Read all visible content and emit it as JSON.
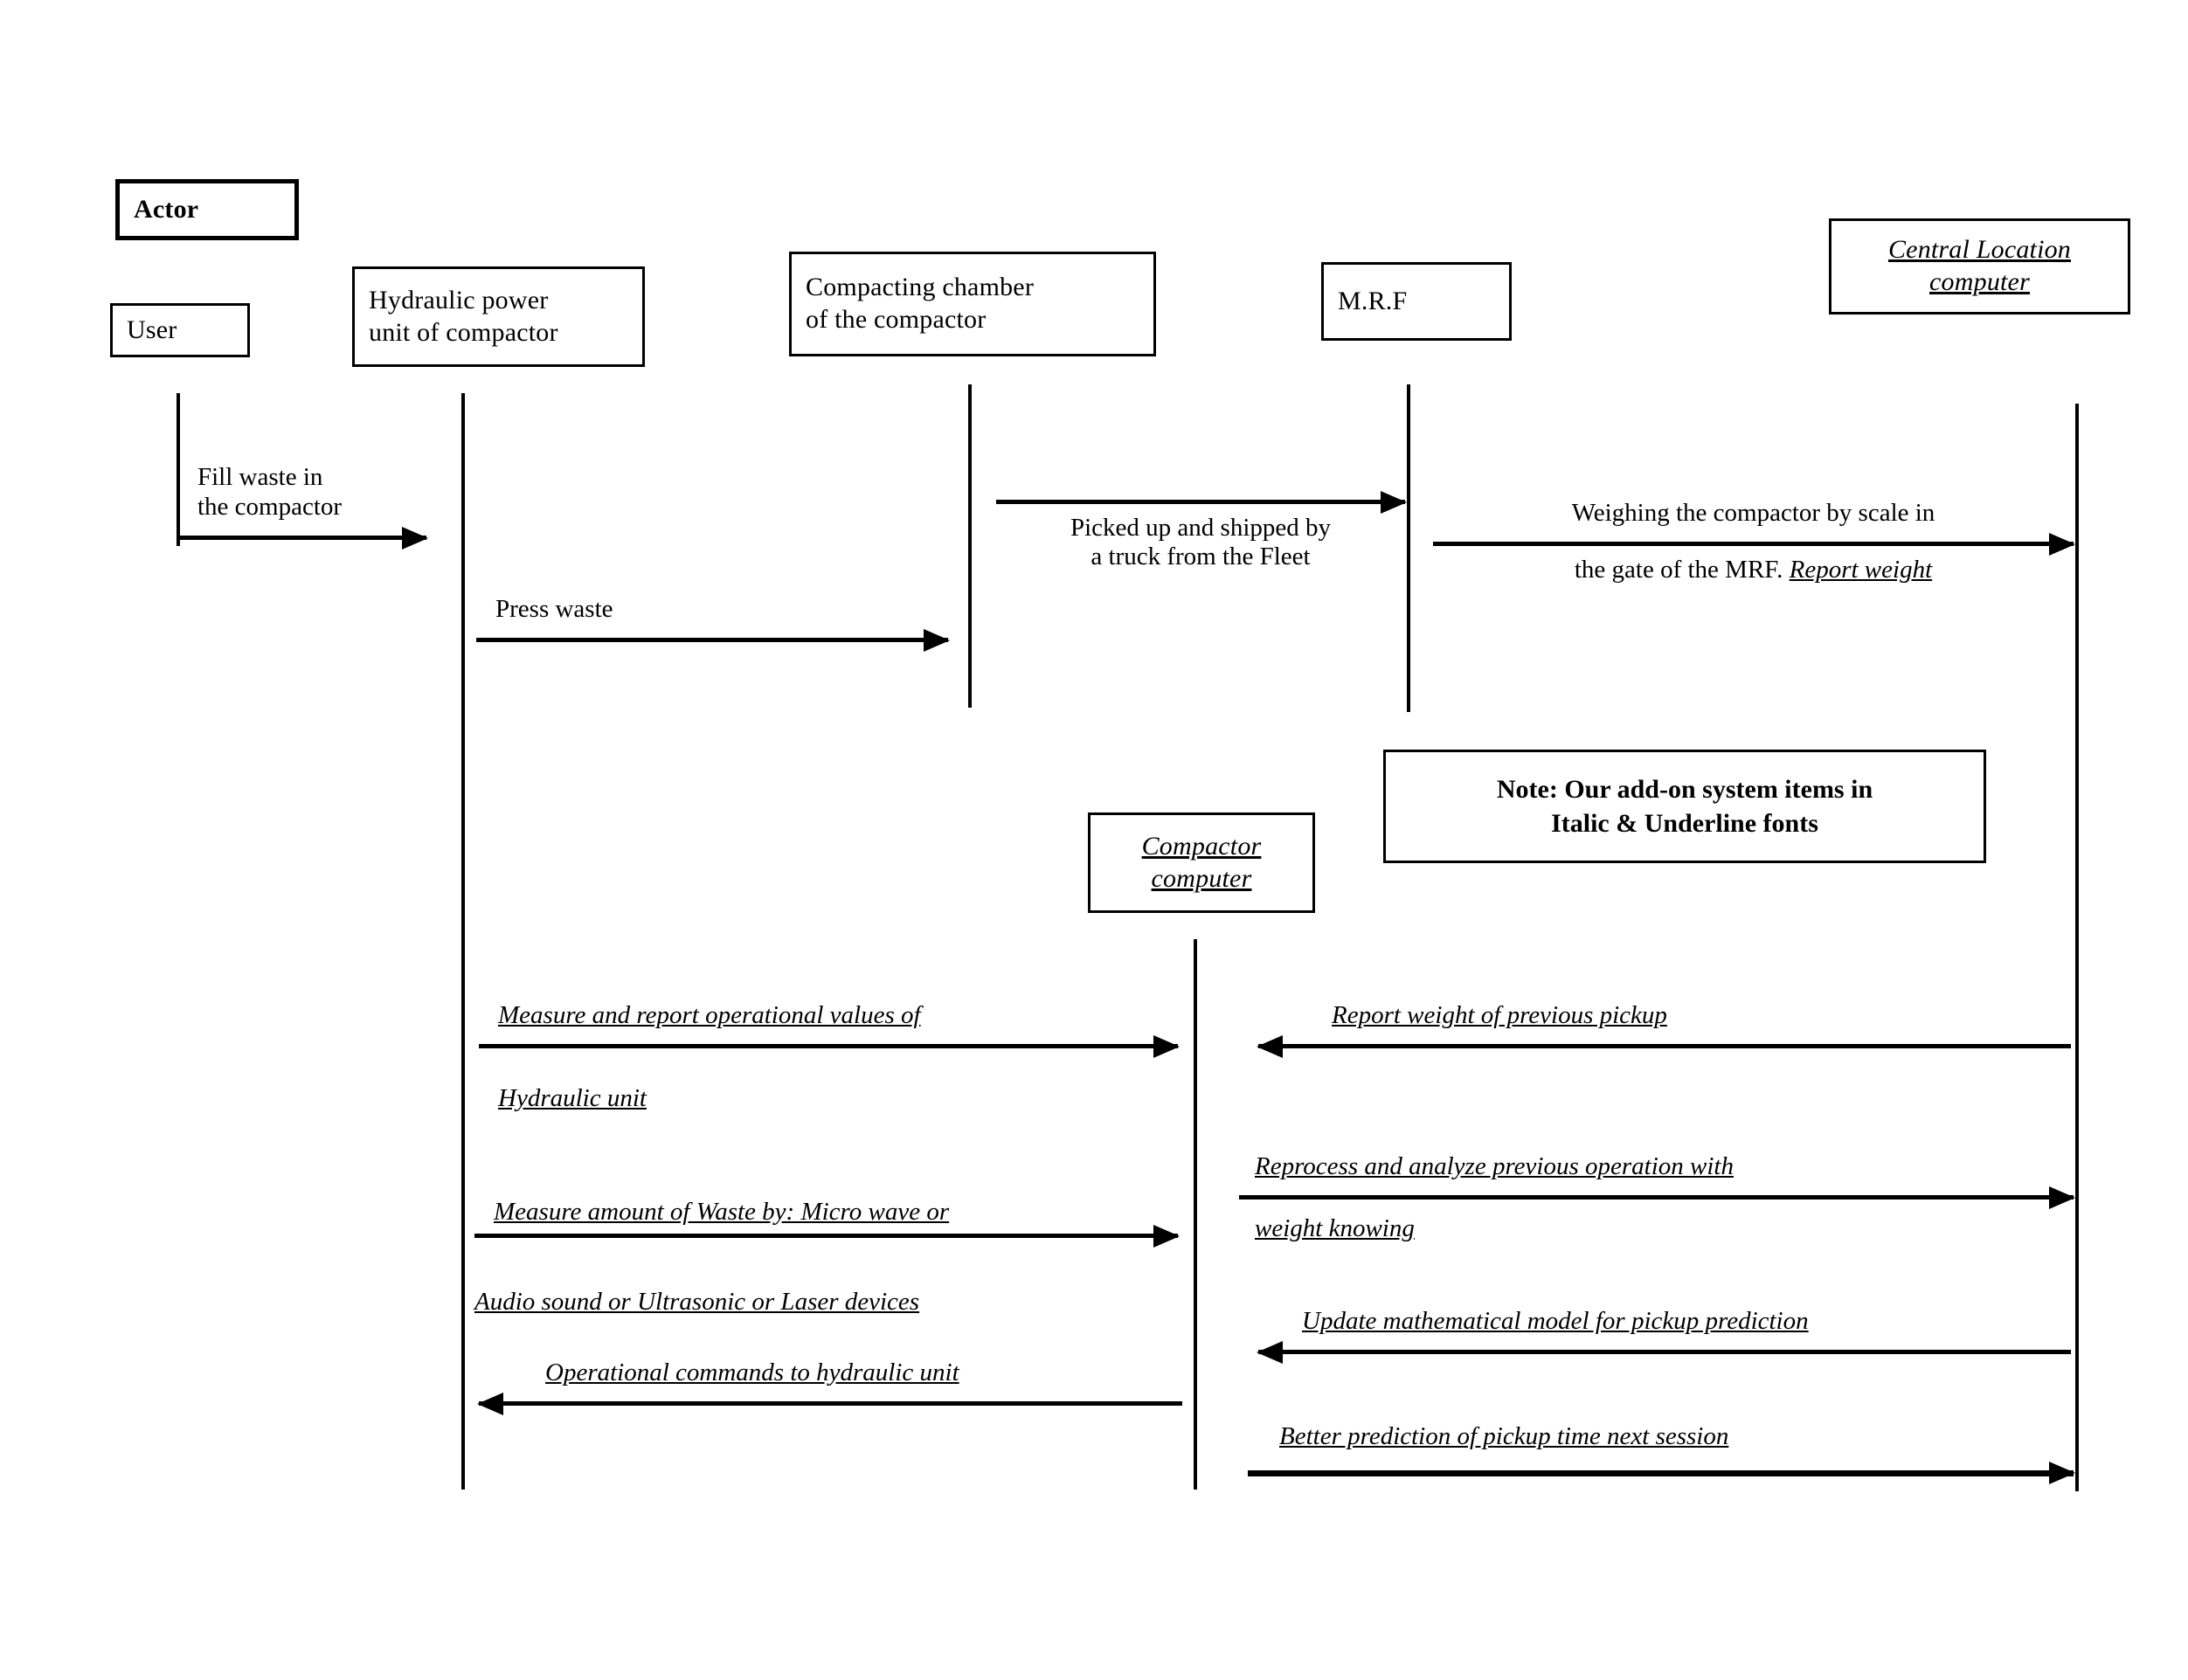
{
  "diagram": {
    "title": "Waste compactor add-on system sequence diagram",
    "type": "uml-sequence-diagram",
    "ink_color": "#000000",
    "background_color": "#ffffff"
  },
  "actor_legend": {
    "header_label": "Actor",
    "actor_label": "User"
  },
  "participants": [
    {
      "id": "user",
      "label": "User",
      "addon": false
    },
    {
      "id": "hydraulic",
      "label": "Hydraulic power\nunit of compactor",
      "line1": "Hydraulic power",
      "line2": "unit of compactor",
      "addon": false
    },
    {
      "id": "chamber",
      "label": "Compacting chamber\nof the compactor",
      "line1": "Compacting chamber",
      "line2": "of the compactor",
      "addon": false
    },
    {
      "id": "mrf",
      "label": "M.R.F",
      "addon": false
    },
    {
      "id": "central",
      "label": "Central Location\ncomputer",
      "line1": "Central Location",
      "line2": "computer",
      "addon": true
    },
    {
      "id": "compactor_computer",
      "label": "Compactor\ncomputer",
      "line1": "Compactor",
      "line2": "computer",
      "addon": true
    }
  ],
  "note": {
    "line1": "Note: Our add-on system items in",
    "line2": "Italic & Underline fonts"
  },
  "messages": [
    {
      "id": "m1",
      "from": "user",
      "to": "hydraulic",
      "direction": "right",
      "label_line1": "Fill waste in",
      "label_line2": "the compactor",
      "addon": false
    },
    {
      "id": "m2",
      "from": "hydraulic",
      "to": "chamber",
      "direction": "right",
      "label_line1": "Press waste",
      "label_line2": "",
      "addon": false
    },
    {
      "id": "m3",
      "from": "chamber",
      "to": "mrf",
      "direction": "right",
      "label_line1": "Picked up and shipped by",
      "label_line2": "a truck from the Fleet",
      "addon": false
    },
    {
      "id": "m4",
      "from": "mrf",
      "to": "central",
      "direction": "right",
      "label_line1": "Weighing the compactor by scale in",
      "label_line2_plain": "the gate of the MRF. ",
      "label_line2_addon": "Report weight",
      "addon": false
    },
    {
      "id": "m5",
      "from": "hydraulic",
      "to": "compactor_computer",
      "direction": "right",
      "label_line1": "Measure and report operational values of",
      "label_line2": "Hydraulic unit",
      "addon": true
    },
    {
      "id": "m6",
      "from": "hydraulic",
      "to": "compactor_computer",
      "direction": "right",
      "label_line1": "Measure amount of Waste by: Micro wave or",
      "label_line2": "Audio sound or Ultrasonic or Laser devices",
      "addon": true
    },
    {
      "id": "m7",
      "from": "compactor_computer",
      "to": "hydraulic",
      "direction": "left",
      "label_line1": "Operational commands to hydraulic unit",
      "label_line2": "",
      "addon": true
    },
    {
      "id": "m8",
      "from": "central",
      "to": "compactor_computer",
      "direction": "left",
      "label_line1": "Report weight of previous pickup",
      "label_line2": "",
      "addon": true
    },
    {
      "id": "m9",
      "from": "compactor_computer",
      "to": "central",
      "direction": "right",
      "label_line1": "Reprocess and analyze previous operation with",
      "label_line2": "weight knowing",
      "addon": true
    },
    {
      "id": "m10",
      "from": "central",
      "to": "compactor_computer",
      "direction": "left",
      "label_line1": "Update mathematical model for pickup prediction",
      "label_line2": "",
      "addon": true
    },
    {
      "id": "m11",
      "from": "compactor_computer",
      "to": "central",
      "direction": "right",
      "label_line1": "Better prediction of pickup time next session",
      "label_line2": "",
      "addon": true
    }
  ]
}
